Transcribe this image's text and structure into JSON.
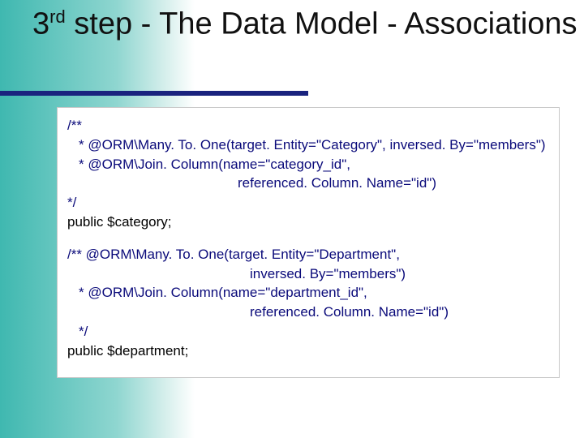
{
  "title": {
    "ordinal": "3",
    "ordinal_suffix": "rd",
    "rest": " step - The Data Model - Associations"
  },
  "code": {
    "block1": {
      "l1": "/**",
      "l2": " * @ORM\\Many. To. One(target. Entity=\"Category\", inversed. By=\"members\")",
      "l3": " * @ORM\\Join. Column(name=\"category_id\",",
      "l4": "referenced. Column. Name=\"id\")",
      "l5": "*/",
      "l6": "public $category;"
    },
    "block2": {
      "l1": "/** @ORM\\Many. To. One(target. Entity=\"Department\",",
      "l2": "inversed. By=\"members\")",
      "l3": " * @ORM\\Join. Column(name=\"department_id\",",
      "l4": "referenced. Column. Name=\"id\")",
      "l5": " */",
      "l6": "public $department;"
    }
  }
}
